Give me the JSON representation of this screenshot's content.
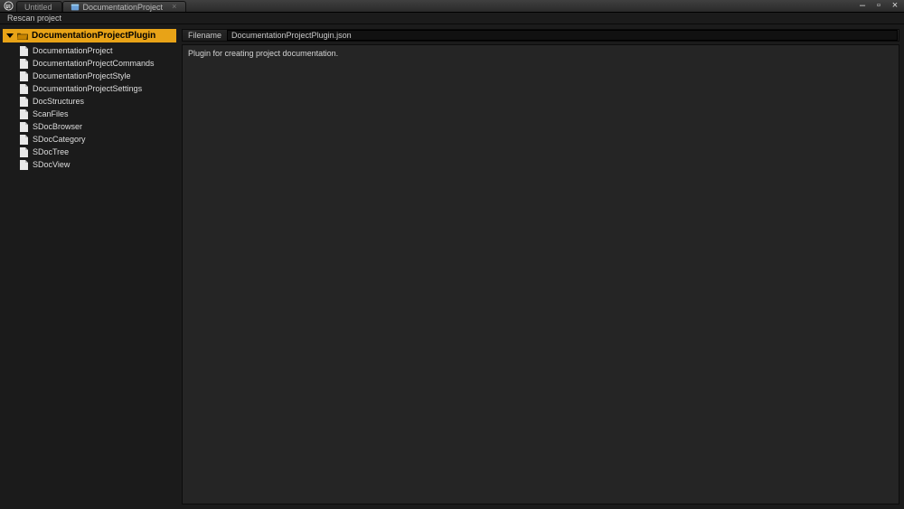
{
  "titlebar": {
    "tabs": [
      {
        "label": "Untitled",
        "active": false
      },
      {
        "label": "DocumentationProject",
        "active": true
      }
    ]
  },
  "menubar": {
    "rescan": "Rescan project"
  },
  "sidebar": {
    "root": "DocumentationProjectPlugin",
    "items": [
      {
        "label": "DocumentationProject"
      },
      {
        "label": "DocumentationProjectCommands"
      },
      {
        "label": "DocumentationProjectStyle"
      },
      {
        "label": "DocumentationProjectSettings"
      },
      {
        "label": "DocStructures"
      },
      {
        "label": "ScanFiles"
      },
      {
        "label": "SDocBrowser"
      },
      {
        "label": "SDocCategory"
      },
      {
        "label": "SDocTree"
      },
      {
        "label": "SDocView"
      }
    ]
  },
  "content": {
    "filename_label": "Filename",
    "filename_value": "DocumentationProjectPlugin.json",
    "description": "Plugin for creating project documentation."
  }
}
